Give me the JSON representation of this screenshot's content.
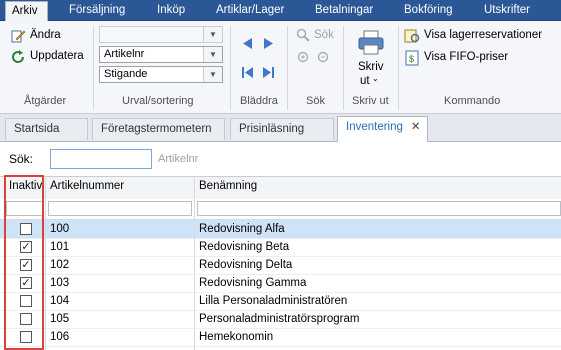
{
  "menubar": {
    "items": [
      "Arkiv",
      "Försäljning",
      "Inköp",
      "Artiklar/Lager",
      "Betalningar",
      "Bokföring",
      "Utskrifter"
    ]
  },
  "ribbon": {
    "atgarder": {
      "andra": "Ändra",
      "uppdatera": "Uppdatera",
      "label": "Åtgärder"
    },
    "urval": {
      "combo1": "",
      "combo2": "Artikelnr",
      "combo3": "Stigande",
      "label": "Urval/sortering"
    },
    "bladdra": {
      "label": "Bläddra"
    },
    "sok": {
      "button": "Sök",
      "label": "Sök"
    },
    "skrivut": {
      "line1": "Skriv",
      "line2": "ut",
      "label": "Skriv ut"
    },
    "kommando": {
      "lager": "Visa lagerreservationer",
      "fifo": "Visa FIFO-priser",
      "label": "Kommando"
    }
  },
  "tabs": [
    {
      "label": "Startsida"
    },
    {
      "label": "Företagstermometern"
    },
    {
      "label": "Prisinläsning"
    },
    {
      "label": "Inventering"
    }
  ],
  "search": {
    "label": "Sök:",
    "hint": "Artikelnr",
    "value": ""
  },
  "grid": {
    "columns": [
      "Inaktiv",
      "Artikelnummer",
      "Benämning"
    ],
    "rows": [
      {
        "inaktiv": false,
        "artnr": "100",
        "namn": "Redovisning Alfa"
      },
      {
        "inaktiv": true,
        "artnr": "101",
        "namn": "Redovisning Beta"
      },
      {
        "inaktiv": true,
        "artnr": "102",
        "namn": "Redovisning Delta"
      },
      {
        "inaktiv": true,
        "artnr": "103",
        "namn": "Redovisning Gamma"
      },
      {
        "inaktiv": false,
        "artnr": "104",
        "namn": "Lilla Personaladministratören"
      },
      {
        "inaktiv": false,
        "artnr": "105",
        "namn": "Personaladministratörsprogram"
      },
      {
        "inaktiv": false,
        "artnr": "106",
        "namn": "Hemekonomin"
      }
    ]
  },
  "colors": {
    "menubar": "#2b5797",
    "highlight": "#d94040",
    "selected_row": "#cfe3f7",
    "active_tab_text": "#2b6cb8"
  }
}
